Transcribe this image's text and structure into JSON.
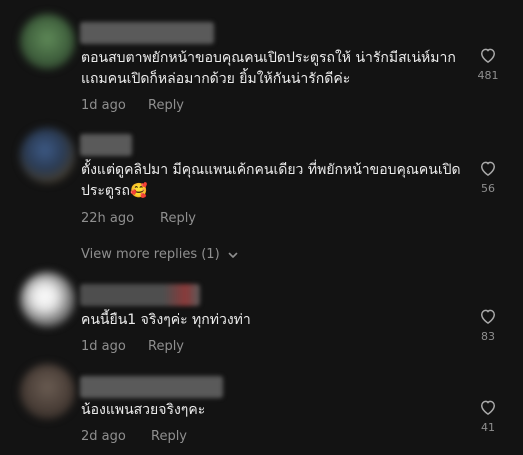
{
  "colors": {
    "background": "#131313",
    "text": "#ececec",
    "muted": "#8f8f8f"
  },
  "comments": [
    {
      "text": "ตอนสบตาพยักหน้าขอบคุณคนเปิดประตูรถให้ น่ารักมีสเน่ห์มาก แถมคนเปิดก็หล่อมากด้วย ยิ้มให้กันน่ารักดีค่ะ",
      "time": "1d ago",
      "reply_label": "Reply",
      "likes": "481",
      "icon": "heart-outline"
    },
    {
      "text": "ตั้งแต่ดูคลิปมา มีคุณแพนเค้กคนเดียว ที่พยักหน้าขอบคุณคนเปิดประตูรถ🥰",
      "time": "22h ago",
      "reply_label": "Reply",
      "likes": "56",
      "icon": "heart-outline"
    },
    {
      "text": "คนนี้ยืน1 จริงๆค่ะ ทุกท่วงท่า",
      "time": "1d ago",
      "reply_label": "Reply",
      "likes": "83",
      "icon": "heart-outline"
    },
    {
      "text": "น้องแพนสวยจริงๆคะ",
      "time": "2d ago",
      "reply_label": "Reply",
      "likes": "41",
      "icon": "heart-outline"
    }
  ],
  "view_more": {
    "label": "View more replies (1)",
    "icon": "chevron-down"
  }
}
